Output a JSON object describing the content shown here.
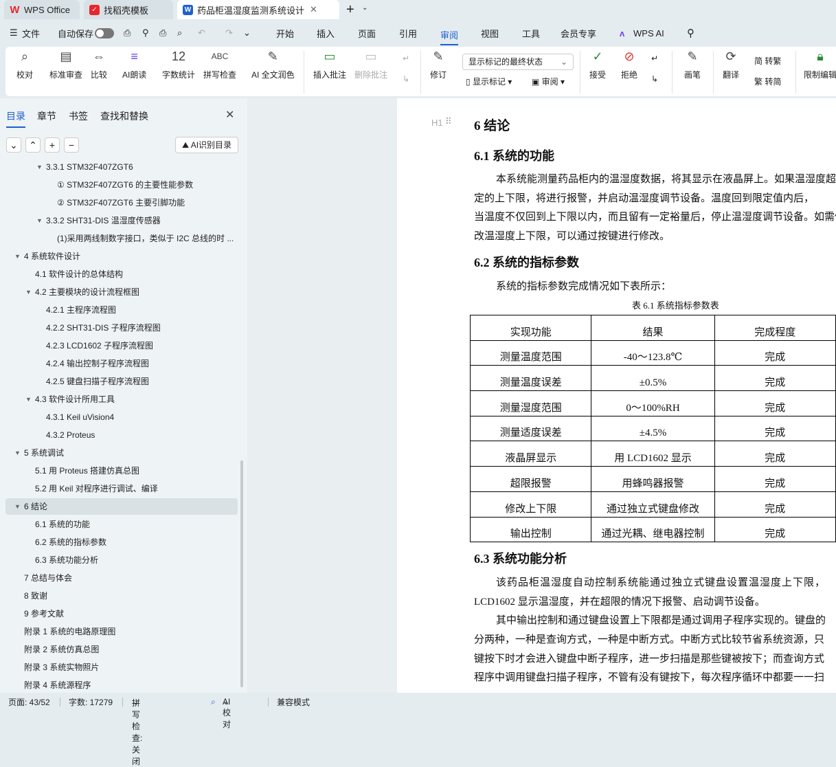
{
  "tabs": [
    {
      "label": "WPS Office",
      "icon": "wps-logo-icon"
    },
    {
      "label": "找稻壳模板",
      "icon": "docer-icon"
    },
    {
      "label": "药品柜温湿度监测系统设计 毕",
      "icon": "word-doc-icon",
      "active": true
    }
  ],
  "menu": {
    "file": "文件",
    "autosave": "自动保存",
    "items": [
      "开始",
      "插入",
      "页面",
      "引用",
      "审阅",
      "视图",
      "工具",
      "会员专享"
    ],
    "active": "审阅",
    "ai": "WPS AI"
  },
  "ribbon": {
    "buttons": [
      "校对",
      "标准审查",
      "比较",
      "AI朗读",
      "字数统计",
      "拼写检查",
      "AI 全文润色",
      "插入批注",
      "删除批注",
      "修订",
      "显示标记",
      "审阅",
      "接受",
      "拒绝",
      "画笔",
      "翻译",
      "限制编辑"
    ],
    "markup_select": "显示标记的最终状态",
    "to_traditional": "转繁",
    "to_simplified": "转简"
  },
  "sidebar": {
    "tabs": [
      "目录",
      "章节",
      "书签",
      "查找和替换"
    ],
    "active_tab": "目录",
    "ai_toc": "AI识别目录",
    "items": [
      {
        "label": "3.3.1 STM32F407ZGT6",
        "level": 2,
        "expandable": true
      },
      {
        "label": "① STM32F407ZGT6 的主要性能参数",
        "level": 3
      },
      {
        "label": "② STM32F407ZGT6 主要引脚功能",
        "level": 3
      },
      {
        "label": "3.3.2 SHT31-DIS 温湿度传感器",
        "level": 2,
        "expandable": true
      },
      {
        "label": "(1)采用两线制数字接口，类似于 I2C 总线的时 ...",
        "level": 3
      },
      {
        "label": "4  系统软件设计",
        "level": 0,
        "expandable": true
      },
      {
        "label": "4.1  软件设计的总体结构",
        "level": 1
      },
      {
        "label": "4.2  主要模块的设计流程框图",
        "level": 1,
        "expandable": true
      },
      {
        "label": "4.2.1  主程序流程图",
        "level": 2
      },
      {
        "label": "4.2.2 SHT31-DIS 子程序流程图",
        "level": 2
      },
      {
        "label": "4.2.3 LCD1602 子程序流程图",
        "level": 2
      },
      {
        "label": "4.2.4  输出控制子程序流程图",
        "level": 2
      },
      {
        "label": "4.2.5  键盘扫描子程序流程图",
        "level": 2
      },
      {
        "label": "4.3  软件设计所用工具",
        "level": 1,
        "expandable": true
      },
      {
        "label": "4.3.1 Keil uVision4",
        "level": 2
      },
      {
        "label": "4.3.2 Proteus",
        "level": 2
      },
      {
        "label": "5  系统调试",
        "level": 0,
        "expandable": true
      },
      {
        "label": "5.1  用 Proteus 搭建仿真总图",
        "level": 1
      },
      {
        "label": "5.2  用 Keil 对程序进行调试、编译",
        "level": 1
      },
      {
        "label": "6  结论",
        "level": 0,
        "expandable": true,
        "selected": true
      },
      {
        "label": "6.1  系统的功能",
        "level": 1
      },
      {
        "label": "6.2  系统的指标参数",
        "level": 1
      },
      {
        "label": "6.3  系统功能分析",
        "level": 1
      },
      {
        "label": "7  总结与体会",
        "level": 0
      },
      {
        "label": "8  致谢",
        "level": 0
      },
      {
        "label": "9  参考文献",
        "level": 0
      },
      {
        "label": "附录 1  系统的电路原理图",
        "level": 0
      },
      {
        "label": "附录 2  系统仿真总图",
        "level": 0
      },
      {
        "label": "附录 3  系统实物照片",
        "level": 0
      },
      {
        "label": "附录 4  系统源程序",
        "level": 0
      }
    ]
  },
  "document": {
    "h1": "6  结论",
    "h1_marker": "H1",
    "s61": "6.1  系统的功能",
    "p1": [
      "本系统能测量药品柜内的温湿度数据，将其显示在液晶屏上。如果温湿度超出设",
      "定的上下限，将进行报警，并启动温湿度调节设备。温度回到限定值内后，",
      "当温度不仅回到上下限以内，而且留有一定裕量后，停止温湿度调节设备。如需修",
      "改温湿度上下限，可以通过按键进行修改。"
    ],
    "s62": "6.2  系统的指标参数",
    "p2": "系统的指标参数完成情况如下表所示：",
    "caption": "表 6.1  系统指标参数表",
    "table": {
      "headers": [
        "实现功能",
        "结果",
        "完成程度"
      ],
      "rows": [
        [
          "测量温度范围",
          "-40～123.8℃",
          "完成"
        ],
        [
          "测量温度误差",
          "±0.5%",
          "完成"
        ],
        [
          "测量湿度范围",
          "0～100%RH",
          "完成"
        ],
        [
          "测量适度误差",
          "±4.5%",
          "完成"
        ],
        [
          "液晶屏显示",
          "用 LCD1602 显示",
          "完成"
        ],
        [
          "超限报警",
          "用蜂鸣器报警",
          "完成"
        ],
        [
          "修改上下限",
          "通过独立式键盘修改",
          "完成"
        ],
        [
          "输出控制",
          "通过光耦、继电器控制",
          "完成"
        ]
      ]
    },
    "s63": "6.3  系统功能分析",
    "p3": [
      "该药品柜温湿度自动控制系统能通过独立式键盘设置温湿度上下限，",
      "LCD1602 显示温湿度，并在超限的情况下报警、启动调节设备。",
      "其中输出控制和通过键盘设置上下限都是通过调用子程序实现的。键盘的",
      "分两种，一种是查询方式，一种是中断方式。中断方式比较节省系统资源，只",
      "键按下时才会进入键盘中断子程序，进一步扫描是那些键被按下；而查询方式",
      "程序中调用键盘扫描子程序，不管有没有键按下，每次程序循环中都要一一扫"
    ]
  },
  "status": {
    "page": "页面: 43/52",
    "words": "字数: 17279",
    "spell": "拼写检查: 关闭",
    "ai_check": "AI 校对",
    "compat": "兼容模式"
  },
  "colors": {
    "accent": "#1f5fd1",
    "wps_red": "#e8262d"
  }
}
